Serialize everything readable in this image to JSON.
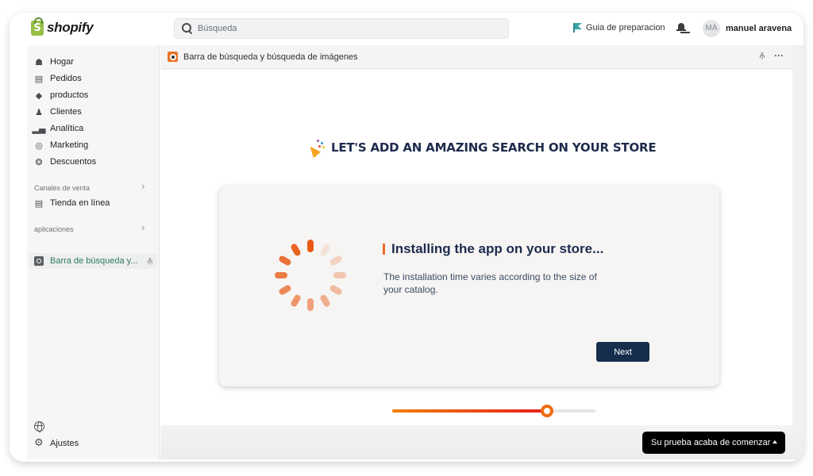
{
  "topbar": {
    "brand": "shopify",
    "search_placeholder": "Búsqueda",
    "setup_guide": "Guia de preparacion",
    "user_initials": "MA",
    "user_name": "manuel aravena"
  },
  "sidebar": {
    "items": [
      {
        "label": "Hogar",
        "icon": "home-icon"
      },
      {
        "label": "Pedidos",
        "icon": "orders-icon"
      },
      {
        "label": "productos",
        "icon": "tag-icon"
      },
      {
        "label": "Clientes",
        "icon": "person-icon"
      },
      {
        "label": "Analítica",
        "icon": "bar-chart-icon"
      },
      {
        "label": "Marketing",
        "icon": "target-icon"
      },
      {
        "label": "Descuentos",
        "icon": "discount-icon"
      }
    ],
    "sales_channels_label": "Canales de venta",
    "online_store": "Tienda en línea",
    "apps_label": "aplicaciones",
    "active_app": "Barra de búsqueda y...",
    "settings": "Ajustes"
  },
  "app_header": {
    "title": "Barra de búsqueda y búsqueda de imágenes"
  },
  "content": {
    "hero_title": "LET'S ADD AN AMAZING SEARCH ON YOUR STORE",
    "install_title": "Installing the app on your store...",
    "install_desc": "The installation time varies according to the size of your catalog.",
    "next_button": "Next",
    "progress_percent": 76
  },
  "trial_banner": {
    "label": "Su prueba acaba de comenzar"
  },
  "colors": {
    "accent": "#ee6b2a",
    "navy": "#162e4d",
    "shopify_green": "#95bf47",
    "active_nav": "#2e7d5b"
  }
}
